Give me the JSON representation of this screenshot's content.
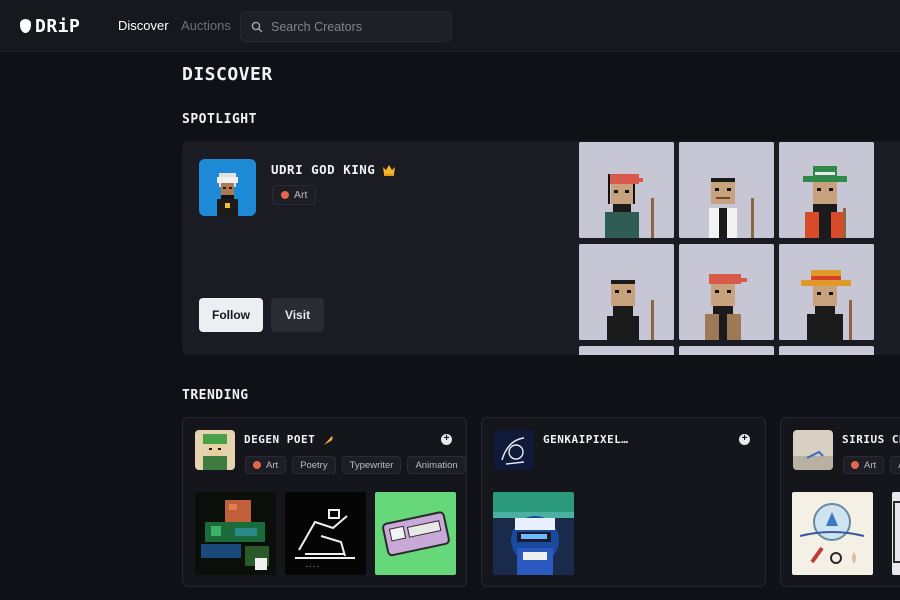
{
  "brand": {
    "name": "DRiP"
  },
  "nav": {
    "discover": "Discover",
    "auctions": "Auctions"
  },
  "search": {
    "placeholder": "Search Creators"
  },
  "page": {
    "title": "DISCOVER"
  },
  "spotlight": {
    "heading": "SPOTLIGHT",
    "creator": {
      "name": "UDRI GOD KING",
      "tag": "Art",
      "verified_icon": "crown-icon"
    },
    "follow_label": "Follow",
    "visit_label": "Visit"
  },
  "trending": {
    "heading": "TRENDING",
    "cards": [
      {
        "name": "DEGEN POET",
        "badge_icon": "feather-icon",
        "tags": [
          "Art",
          "Poetry",
          "Typewriter",
          "Animation"
        ]
      },
      {
        "name": "GENKAIPIXEL…",
        "tags": []
      },
      {
        "name": "SIRIUS CR",
        "tags": [
          "Art",
          "Ani"
        ]
      }
    ]
  },
  "colors": {
    "background": "#101116",
    "card": "#1b1c23",
    "accent_tag": "#e4664f",
    "tile_bg": "#c8c8d6"
  }
}
